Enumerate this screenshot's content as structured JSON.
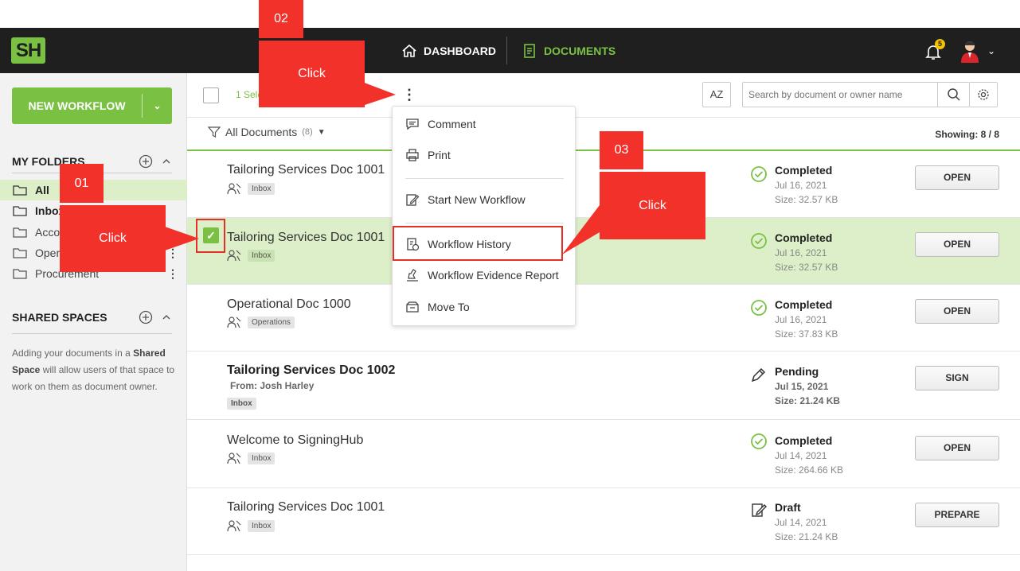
{
  "nav": {
    "logo_text": "SH",
    "dashboard_label": "DASHBOARD",
    "documents_label": "DOCUMENTS",
    "notifications_count": "5"
  },
  "sidebar": {
    "new_workflow_label": "NEW WORKFLOW",
    "my_folders_title": "MY FOLDERS",
    "folders": [
      {
        "label": "All"
      },
      {
        "label": "Inbox"
      },
      {
        "label": "Acco"
      },
      {
        "label": "Oper"
      },
      {
        "label": "Procurement"
      }
    ],
    "shared_spaces_title": "SHARED SPACES",
    "shared_note_1": "Adding your documents in a ",
    "shared_note_bold": "Shared Space",
    "shared_note_2": " will allow users of that space to work on them as document owner."
  },
  "toolbar": {
    "selected_text": "1 Sele",
    "search_placeholder": "Search by document or owner name",
    "sort_label": "AZ"
  },
  "filter": {
    "label": "All Documents",
    "count": "(8)",
    "showing": "Showing: 8  /  8"
  },
  "rows": [
    {
      "title": "Tailoring Services Doc 1001",
      "tag": "Inbox",
      "status": "Completed",
      "date": "Jul 16, 2021",
      "size": "Size: 32.57 KB",
      "action": "OPEN"
    },
    {
      "title": "Tailoring Services Doc 1001",
      "tag": "Inbox",
      "status": "Completed",
      "date": "Jul 16, 2021",
      "size": "Size: 32.57 KB",
      "action": "OPEN"
    },
    {
      "title": "Operational Doc 1000",
      "tag": "Operations",
      "status": "Completed",
      "date": "Jul 16, 2021",
      "size": "Size: 37.83 KB",
      "action": "OPEN"
    },
    {
      "title": "Tailoring Services Doc 1002",
      "from": "From: Josh Harley",
      "tag": "Inbox",
      "status": "Pending",
      "date": "Jul 15, 2021",
      "size": "Size: 21.24 KB",
      "action": "SIGN"
    },
    {
      "title": "Welcome to SigningHub",
      "tag": "Inbox",
      "status": "Completed",
      "date": "Jul 14, 2021",
      "size": "Size: 264.66 KB",
      "action": "OPEN"
    },
    {
      "title": "Tailoring Services Doc 1001",
      "tag": "Inbox",
      "status": "Draft",
      "date": "Jul 14, 2021",
      "size": "Size: 21.24 KB",
      "action": "PREPARE"
    }
  ],
  "menu": {
    "items": [
      {
        "label": "Comment"
      },
      {
        "label": "Print"
      },
      {
        "label": "Start New Workflow"
      },
      {
        "label": "Workflow History"
      },
      {
        "label": "Workflow Evidence Report"
      },
      {
        "label": "Move To"
      }
    ]
  },
  "callouts": {
    "step1_num": "01",
    "step1_label": "Click",
    "step2_num": "02",
    "step2_label": "Click",
    "step3_num": "03",
    "step3_label": "Click"
  },
  "colors": {
    "accent": "#7ac143",
    "callout": "#f2312b",
    "topbar": "#1f1f1f"
  }
}
